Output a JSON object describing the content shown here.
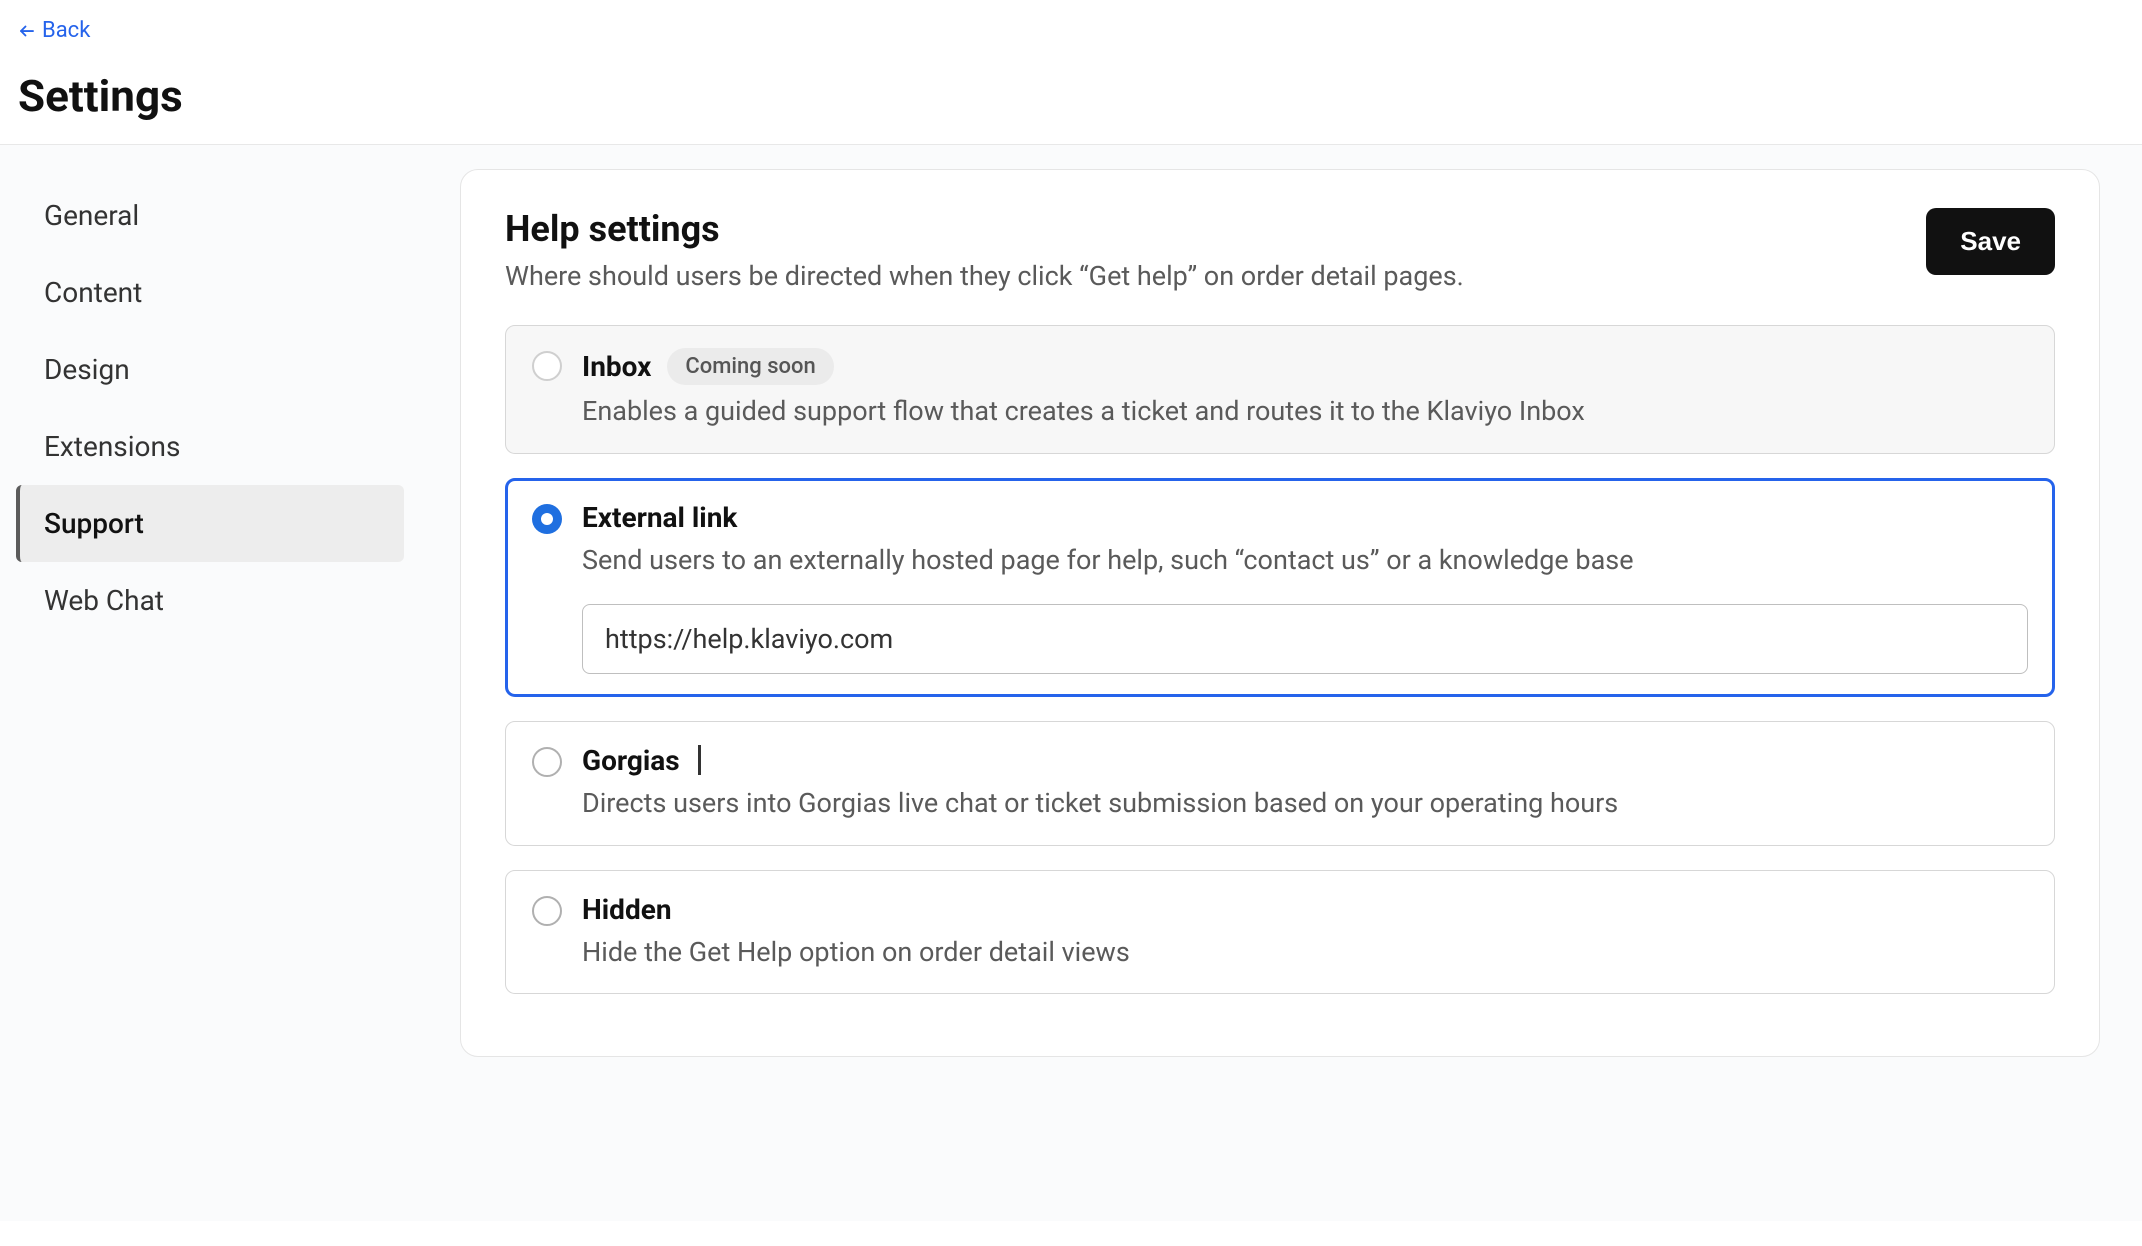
{
  "header": {
    "back_label": "Back",
    "page_title": "Settings"
  },
  "sidebar": {
    "items": [
      {
        "label": "General",
        "active": false
      },
      {
        "label": "Content",
        "active": false
      },
      {
        "label": "Design",
        "active": false
      },
      {
        "label": "Extensions",
        "active": false
      },
      {
        "label": "Support",
        "active": true
      },
      {
        "label": "Web Chat",
        "active": false
      }
    ]
  },
  "panel": {
    "title": "Help settings",
    "subtitle": "Where should users be directed when they click “Get help” on order detail pages.",
    "save_label": "Save"
  },
  "options": [
    {
      "key": "inbox",
      "title": "Inbox",
      "badge": "Coming soon",
      "desc": "Enables a guided support flow that creates a ticket and routes it to the Klaviyo Inbox",
      "selected": false,
      "disabled": true
    },
    {
      "key": "external",
      "title": "External link",
      "desc": "Send users to an externally hosted page for help, such “contact us” or a knowledge base",
      "selected": true,
      "disabled": false,
      "input_value": "https://help.klaviyo.com"
    },
    {
      "key": "gorgias",
      "title": "Gorgias",
      "desc": "Directs users into Gorgias live chat or ticket submission based on your operating hours",
      "selected": false,
      "disabled": false
    },
    {
      "key": "hidden",
      "title": "Hidden",
      "desc": "Hide the Get Help option on order detail views",
      "selected": false,
      "disabled": false
    }
  ]
}
